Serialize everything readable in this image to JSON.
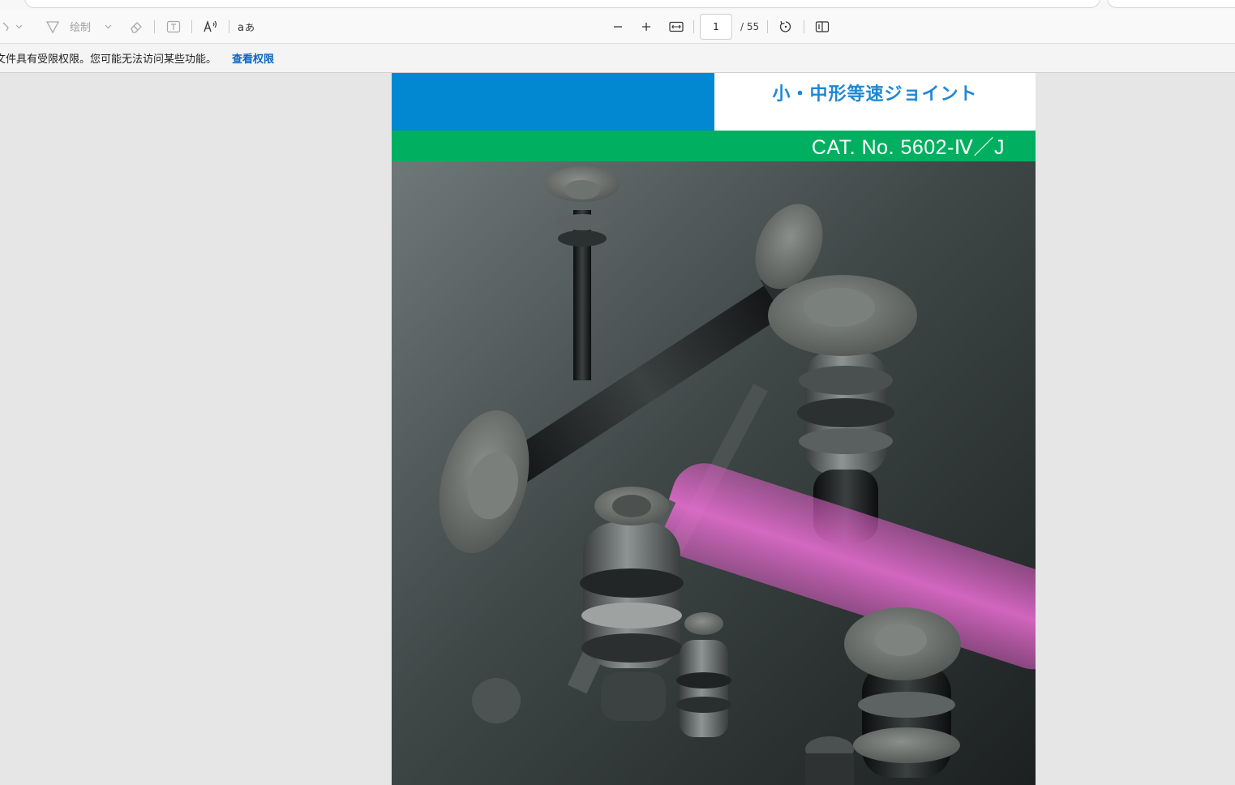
{
  "toolbar": {
    "draw_label": "绘制",
    "page_current": "1",
    "page_total": "/ 55",
    "icons": [
      "highlight-icon",
      "chevron-down-icon",
      "draw-icon",
      "chevron-down-icon",
      "eraser-icon",
      "text-box-icon",
      "read-aloud-icon",
      "translate-icon",
      "zoom-out-icon",
      "zoom-in-icon",
      "fit-width-icon",
      "rotate-icon",
      "page-view-icon"
    ]
  },
  "infobar": {
    "message": "文件具有受限权限。您可能无法访问某些功能。",
    "link": "查看权限"
  },
  "document": {
    "title": "小・中形等速ジョイント",
    "catalog_number": "CAT. No. 5602-Ⅳ／J",
    "colors": {
      "blue": "#0288d1",
      "green": "#00b060",
      "title": "#1e88d4"
    }
  }
}
